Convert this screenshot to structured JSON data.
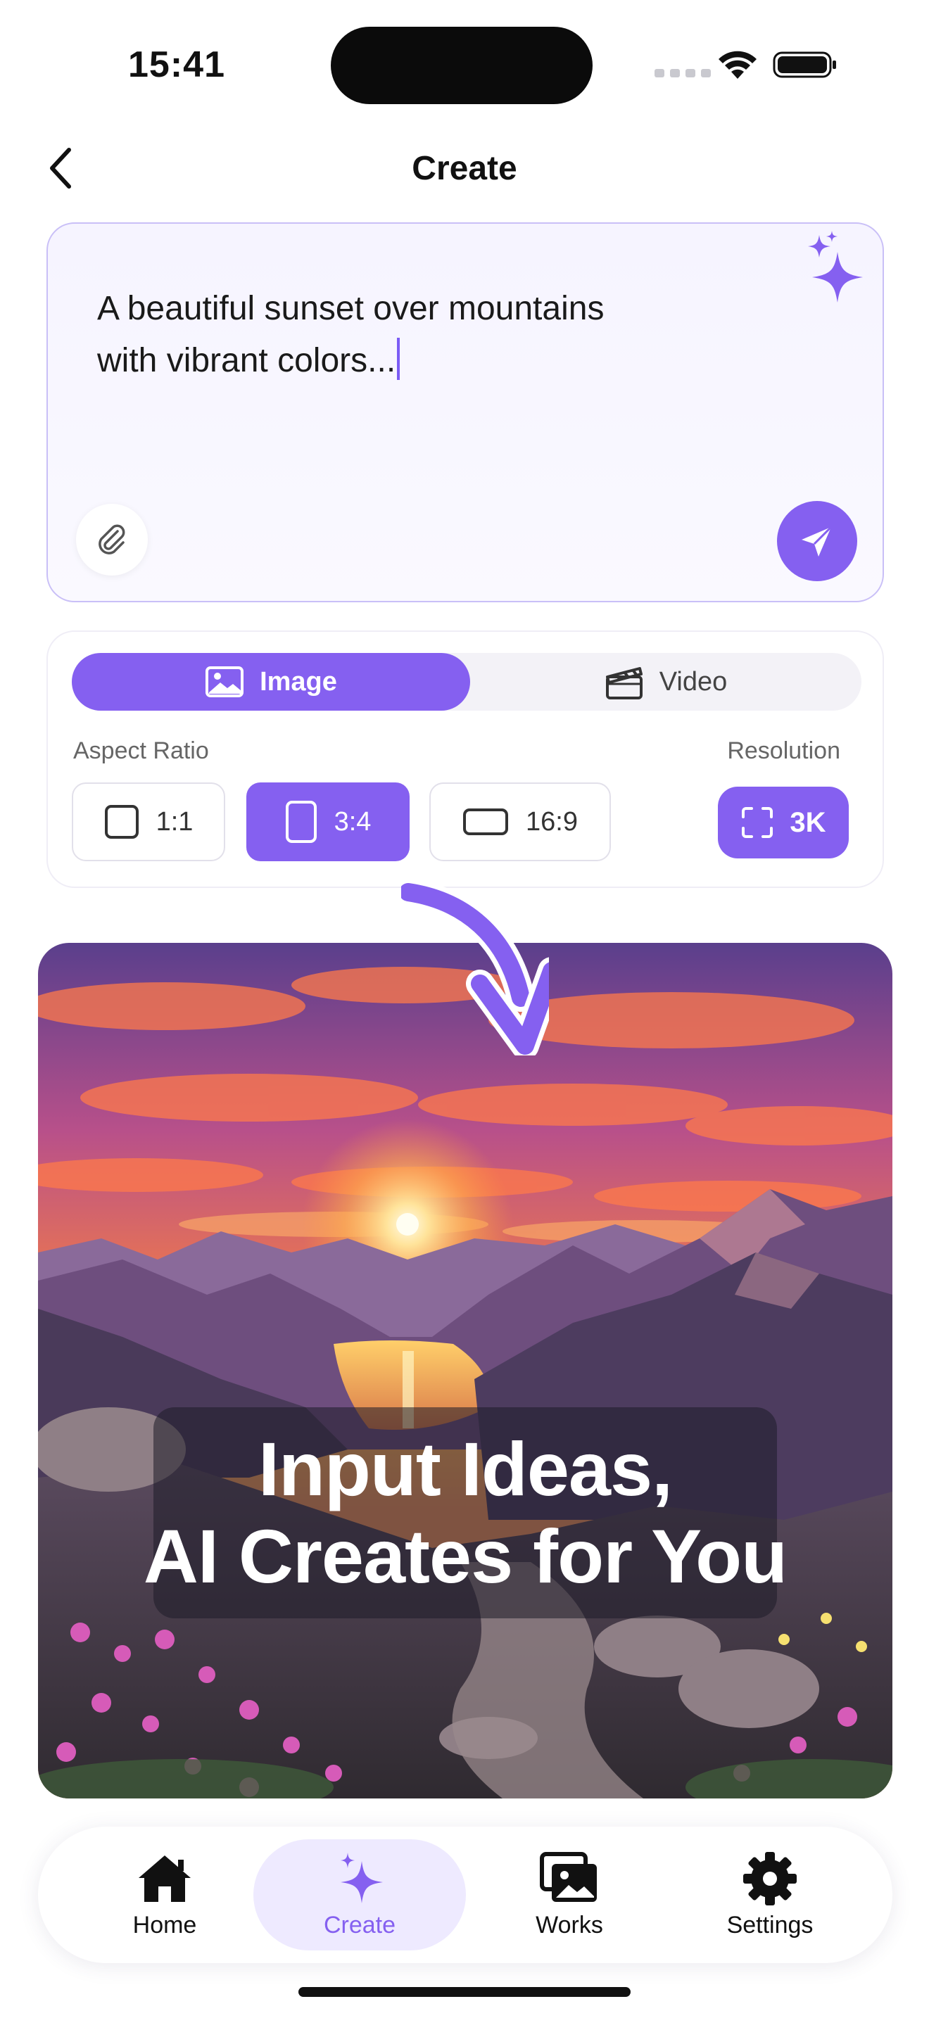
{
  "status_bar": {
    "time": "15:41"
  },
  "header": {
    "title": "Create"
  },
  "prompt": {
    "text_line1": "A beautiful sunset over mountains",
    "text_line2": "with vibrant colors..."
  },
  "options": {
    "media_tabs": [
      {
        "label": "Image",
        "icon": "image-icon",
        "selected": true
      },
      {
        "label": "Video",
        "icon": "clapperboard-icon",
        "selected": false
      }
    ],
    "aspect_ratio_label": "Aspect Ratio",
    "resolution_label": "Resolution",
    "aspect_ratios": [
      {
        "label": "1:1",
        "selected": false
      },
      {
        "label": "3:4",
        "selected": true
      },
      {
        "label": "16:9",
        "selected": false
      }
    ],
    "resolution": {
      "label": "3K",
      "icon": "expand-icon"
    }
  },
  "hero": {
    "headline_line1": "Input Ideas,",
    "headline_line2": "AI Creates for You"
  },
  "tab_bar": {
    "items": [
      {
        "label": "Home",
        "icon": "home-icon"
      },
      {
        "label": "Create",
        "icon": "sparkles-icon",
        "active": true
      },
      {
        "label": "Works",
        "icon": "photos-icon"
      },
      {
        "label": "Settings",
        "icon": "gear-icon"
      }
    ]
  },
  "colors": {
    "accent": "#8560f0",
    "accent_light": "#eeeaff"
  }
}
